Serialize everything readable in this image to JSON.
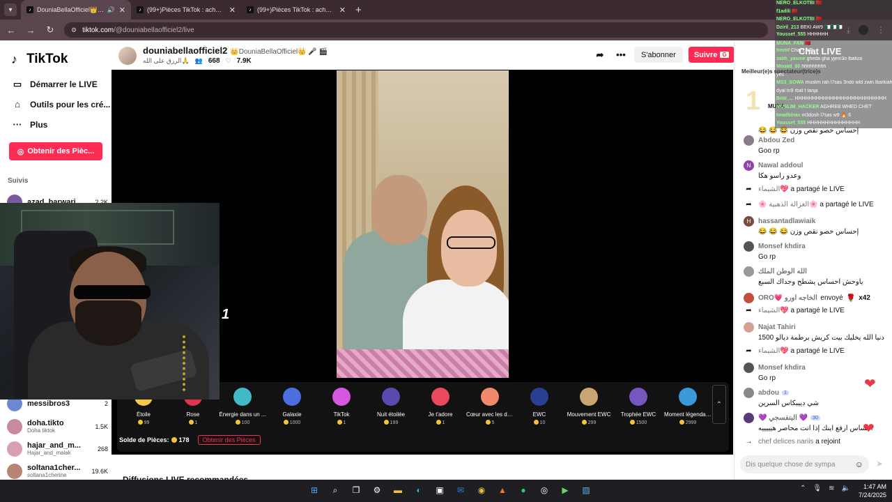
{
  "browser": {
    "tabs": [
      {
        "title": "DouniaBellaOfficiel👑 🎤 🎬",
        "active": true
      },
      {
        "title": "(99+)Pièces TikTok : achète et re",
        "active": false
      },
      {
        "title": "(99+)Pièces TikTok : achète et re",
        "active": false
      }
    ],
    "url_host": "tiktok.com",
    "url_path": "/@douniabellaofficiel2/live"
  },
  "sidebar": {
    "logo": "TikTok",
    "nav": [
      {
        "label": "Démarrer le LIVE",
        "icon": "camera-icon"
      },
      {
        "label": "Outils pour les cré...",
        "icon": "house-icon"
      },
      {
        "label": "Plus",
        "icon": "more-icon"
      }
    ],
    "get_coins": "Obtenir des Pièc...",
    "following_title": "Suivis",
    "following": [
      {
        "name": "azad_barwari...",
        "sub": "",
        "count": "2.2K",
        "color": "#7a5a9c"
      },
      {
        "name": "messibros3",
        "sub": "",
        "count": "2",
        "color": "#6a8ad0"
      },
      {
        "name": "doha.tikto",
        "sub": "Doha tiktok",
        "count": "1.5K",
        "color": "#c78aa0"
      },
      {
        "name": "hajar_and_m...",
        "sub": "Hajar_and_malak",
        "count": "268",
        "color": "#d9a0b5"
      },
      {
        "name": "soltana1cher...",
        "sub": "soltana1cherine",
        "count": "19.6K",
        "color": "#b88575"
      }
    ]
  },
  "header": {
    "username": "douniabellaofficiel2",
    "nickname": "👑DouniaBellaOfficiel👑 🎤 🎬",
    "tagline": "الرزق على الله🙏",
    "viewers": "668",
    "likes": "7.9K",
    "subscribe_label": "S'abonner",
    "follow_label": "Suivre",
    "follow_key": "G"
  },
  "cam_overlay_text": "1",
  "gifts": [
    {
      "name": "Étoile",
      "price": "99",
      "color": "#f7c843"
    },
    {
      "name": "Rose",
      "price": "1",
      "color": "#e0334f"
    },
    {
      "name": "Énergie dans un ...",
      "price": "100",
      "color": "#41b9c9"
    },
    {
      "name": "Galaxie",
      "price": "1000",
      "color": "#4c6fe0"
    },
    {
      "name": "TikTok",
      "price": "1",
      "color": "#d657e0"
    },
    {
      "name": "Nuit étoilée",
      "price": "199",
      "color": "#5a4ab0"
    },
    {
      "name": "Je t'adore",
      "price": "1",
      "color": "#e8495c"
    },
    {
      "name": "Cœur avec les do...",
      "price": "5",
      "color": "#f08a6a"
    },
    {
      "name": "EWC",
      "price": "10",
      "color": "#2a3f8f"
    },
    {
      "name": "Mouvement EWC",
      "price": "299",
      "color": "#c9a572"
    },
    {
      "name": "Trophée EWC",
      "price": "1500",
      "color": "#7756c0"
    },
    {
      "name": "Moment légendai...",
      "price": "2999",
      "color": "#3a9ad9"
    }
  ],
  "balance": {
    "label": "Solde de Pièces:",
    "value": "178",
    "get_label": "Obtenir des Pièces"
  },
  "recommend_title": "Diffusions LIVE recommandées",
  "chat": {
    "top_title": "Meilleur(e)s spectateur(trice)s",
    "top_rank": "1",
    "top_name": "MUNA",
    "messages": [
      {
        "kind": "text",
        "user": "",
        "text": "😂 😂 😂 إحساس خصو نقص وزن",
        "color": "#b07070"
      },
      {
        "kind": "text",
        "user": "Abdou Zed",
        "text": "Goo rp",
        "color": "#8a7a8a"
      },
      {
        "kind": "text",
        "user": "Nawal addoul",
        "text": "وعدو راسو هكا",
        "color": "#8e44ad",
        "initial": "N"
      },
      {
        "kind": "share",
        "user": "الشيماء💖",
        "text": "a partagé le LIVE"
      },
      {
        "kind": "share",
        "user": "🌸 الغزالة الذهبية🌸",
        "text": "a partagé le LIVE"
      },
      {
        "kind": "text",
        "user": "hassantadlawiaik",
        "text": "😂 😂 😂 إحساس خصو نقص وزن",
        "color": "#7a4a3a",
        "initial": "H"
      },
      {
        "kind": "text",
        "user": "Monsef khdira",
        "text": "Go rp",
        "color": "#555"
      },
      {
        "kind": "text",
        "user": "الله الوطن الملك",
        "text": "ياوحش احساس يشطح وجداك السبع",
        "color": "#999"
      },
      {
        "kind": "gift",
        "user": "ORO💗 الخاجه اورو",
        "text": "envoyé",
        "count": "x42",
        "color": "#c0503a"
      },
      {
        "kind": "share",
        "user": "الشيماء💖",
        "text": "a partagé le LIVE"
      },
      {
        "kind": "text",
        "user": "Najat Tahiri",
        "text": "دنيا الله يخليك بيت كريش برطمة ديالو 1500",
        "color": "#d4a090"
      },
      {
        "kind": "share",
        "user": "الشيماء💖",
        "text": "a partagé le LIVE"
      },
      {
        "kind": "text",
        "user": "Monsef khdira",
        "text": "Go rp",
        "color": "#555"
      },
      {
        "kind": "text",
        "user": "abdou",
        "badge": "1",
        "text": "شي دييبكاس السرين",
        "color": "#888"
      },
      {
        "kind": "text",
        "user": "💜 البنفسجي 💜",
        "badge": "30",
        "text": "احساس ارفع اينك إذا انت محاصر هيييييه",
        "color": "#5a3a7a"
      },
      {
        "kind": "join",
        "user": "chef delices nariis",
        "text": "a rejoint"
      }
    ],
    "input_placeholder": "Dis quelque chose de sympa"
  },
  "stream_chat": {
    "title": "Chat LIVE",
    "lines": [
      {
        "user": "NERO_ELKOTBI",
        "text": "🇲🇦"
      },
      {
        "user": "f1adili",
        "text": "🇲🇦"
      },
      {
        "user": "NERO_ELKOTBI",
        "text": "🇲🇦"
      },
      {
        "user": "Dziril_213",
        "text": "BEKI AW9 🇩🇿🇩🇿🇩🇿"
      },
      {
        "user": "Youssef_555",
        "text": "HHHHHH"
      },
      {
        "user": "MUNA_FAN",
        "text": "🇲🇦"
      },
      {
        "user": "freelif",
        "text": "Chat LIVE"
      },
      {
        "user": "salih_yasine",
        "text": "gheda gha yjem3o lbaliza"
      },
      {
        "user": "Mouad_60",
        "text": "hhhhhhhhh"
      },
      {
        "user": "",
        "text": "yes"
      },
      {
        "user": "MS3_SOWA",
        "text": "muslim rah l7sas 3ndo wld zwin lbarkiah"
      },
      {
        "user": "",
        "text": "dyal tn9 rbat f tanja"
      },
      {
        "user": "Bilal_...",
        "text": "HHHHHHHHHHHHHHHHHHHHHHHHHH"
      },
      {
        "user": "MUSLIM_HACKER",
        "text": "AGHREB WHED CHET"
      },
      {
        "user": "Imadbinas",
        "text": "m3dosh l7sas w9 🔥 6"
      },
      {
        "user": "Youssef_555",
        "text": "HHHHHHHHHHHHHHH"
      }
    ]
  },
  "taskbar": {
    "time": "1:47 AM",
    "date": "7/24/2025"
  }
}
